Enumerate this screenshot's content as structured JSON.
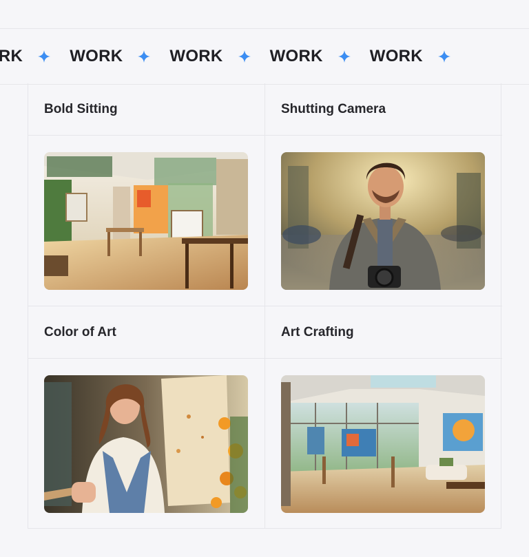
{
  "marquee": {
    "word": "WORK",
    "items": [
      "WORK",
      "WORK",
      "WORK",
      "WORK",
      "WORK"
    ],
    "star_icon": "sparkle-icon",
    "star_color": "#3b8df2"
  },
  "gallery": {
    "items": [
      {
        "title": "Bold Sitting",
        "image": "art-studio-photo"
      },
      {
        "title": "Shutting Camera",
        "image": "photographer-portrait-photo"
      },
      {
        "title": "Color of Art",
        "image": "painter-woman-photo"
      },
      {
        "title": "Art Crafting",
        "image": "bright-studio-photo"
      }
    ]
  }
}
